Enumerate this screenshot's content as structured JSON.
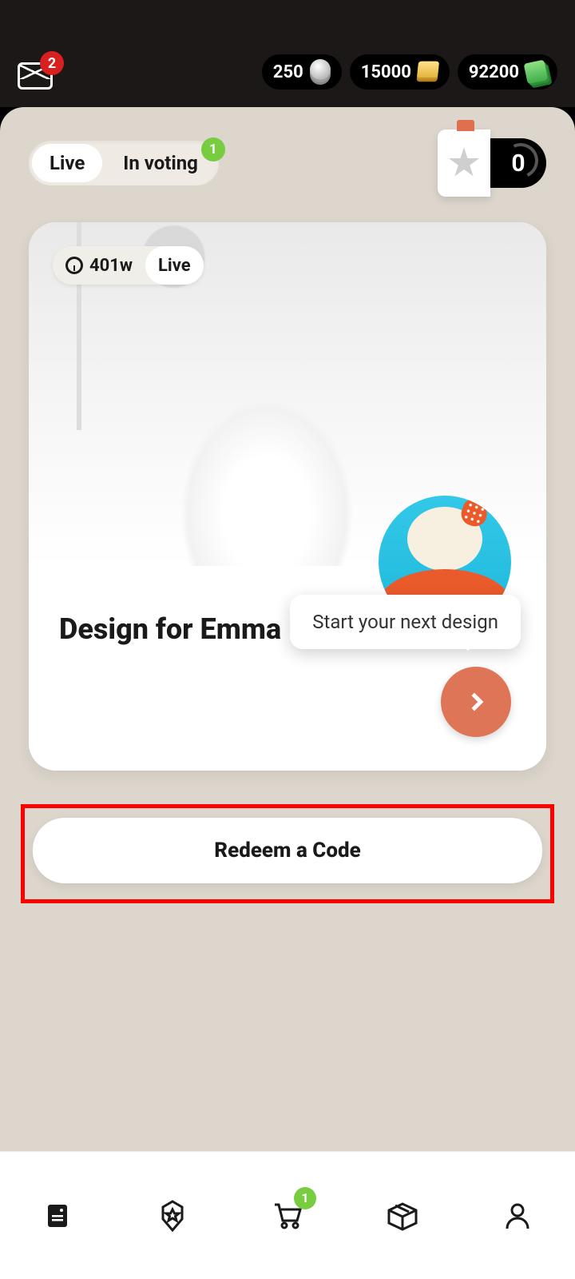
{
  "header": {
    "mail_badge": "2",
    "currencies": [
      {
        "value": "250",
        "icon": "coins-silver"
      },
      {
        "value": "15000",
        "icon": "coins-gold"
      },
      {
        "value": "92200",
        "icon": "cash"
      }
    ]
  },
  "tabs": {
    "items": [
      {
        "label": "Live",
        "active": true
      },
      {
        "label": "In voting",
        "active": false,
        "badge": "1"
      }
    ]
  },
  "star_counter": {
    "count": "0"
  },
  "card": {
    "time_chip": "401w",
    "status_chip": "Live",
    "title": "Design for Emma",
    "tooltip": "Start your next design"
  },
  "redeem": {
    "label": "Redeem a Code"
  },
  "nav": {
    "cart_badge": "1"
  }
}
